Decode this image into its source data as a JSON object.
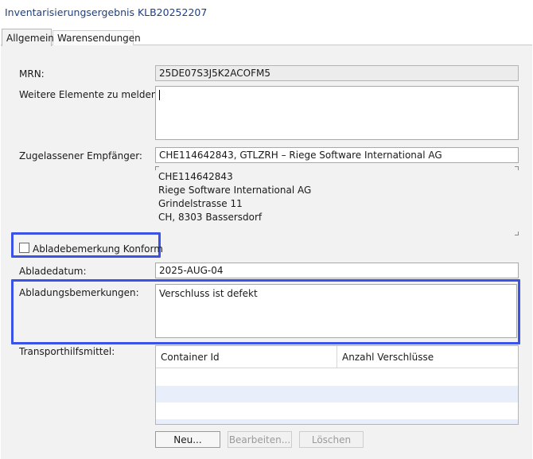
{
  "window": {
    "title": "Inventarisierungsergebnis KLB20252207"
  },
  "tabs": [
    {
      "label": "Allgemein",
      "active": true
    },
    {
      "label": "Warensendungen",
      "active": false
    }
  ],
  "form": {
    "mrn": {
      "label": "MRN:",
      "value": "25DE07S3J5K2ACOFM5"
    },
    "weitere": {
      "label": "Weitere Elemente zu melden:",
      "value": ""
    },
    "empfaenger": {
      "label": "Zugelassener Empfänger:",
      "value": "CHE114642843, GTLZRH – Riege Software International AG",
      "address": [
        "CHE114642843",
        "Riege Software International AG",
        "Grindelstrasse 11",
        "CH, 8303 Bassersdorf"
      ]
    },
    "konform": {
      "label": "Abladebemerkung Konform",
      "checked": false
    },
    "abladedatum": {
      "label": "Abladedatum:",
      "value": "2025-AUG-04"
    },
    "bemerkungen": {
      "label": "Abladungsbemerkungen:",
      "value": "Verschluss ist defekt"
    },
    "transport": {
      "label": "Transporthilfsmittel:",
      "columns": [
        "Container Id",
        "Anzahl Verschlüsse"
      ],
      "rows": []
    }
  },
  "buttons": {
    "new": "Neu...",
    "edit": "Bearbeiten...",
    "delete": "Löschen"
  },
  "colors": {
    "highlight": "#3a53e6",
    "title": "#1f3f80",
    "panel": "#f2f2f2",
    "alt_row": "#e8effa"
  }
}
